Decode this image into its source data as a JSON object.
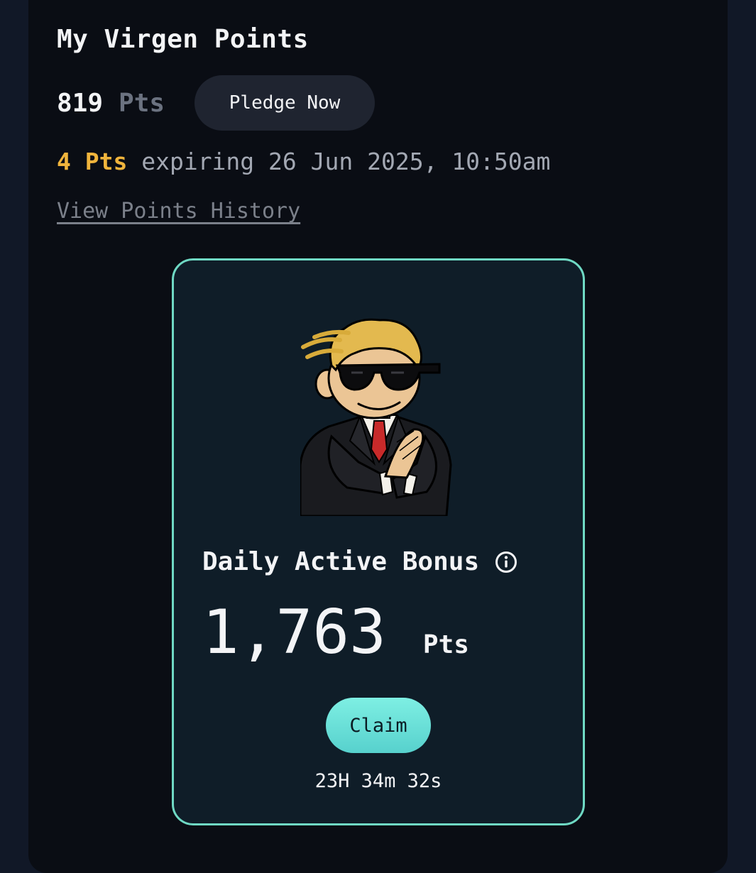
{
  "header": {
    "title": "My Virgen Points"
  },
  "points": {
    "value": "819",
    "unit": "Pts",
    "pledge_label": "Pledge Now"
  },
  "expiry": {
    "amount": "4 Pts",
    "text": "expiring 26 Jun 2025, 10:50am"
  },
  "history_link": "View Points History",
  "bonus": {
    "title": "Daily Active Bonus",
    "info_icon": "info-icon",
    "amount": "1,763",
    "unit": "Pts",
    "claim_label": "Claim",
    "countdown": "23H 34m 32s"
  },
  "colors": {
    "accent": "#6fd9c4",
    "expiry_highlight": "#f0b43c",
    "claim_button": "#67e0d8"
  }
}
